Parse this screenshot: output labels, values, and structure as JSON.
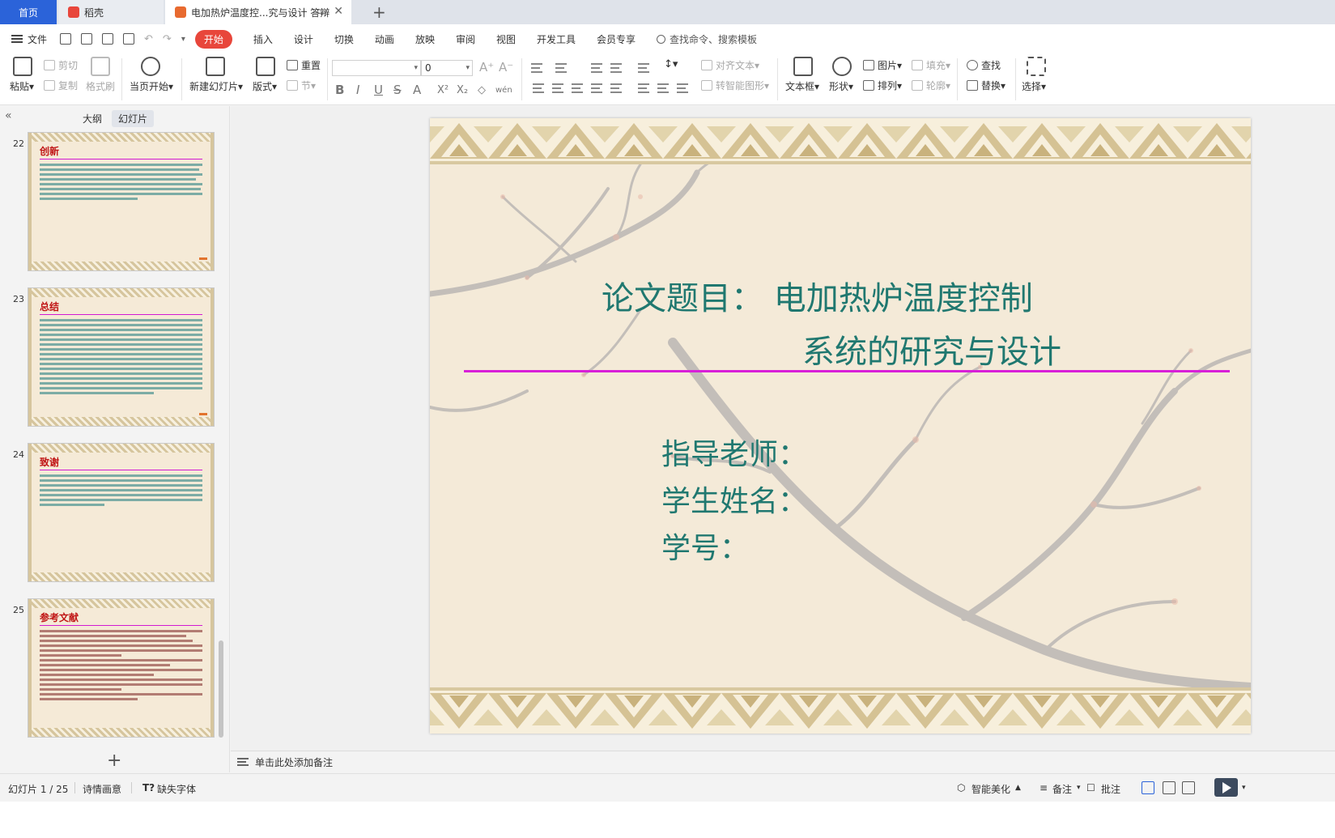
{
  "tabs": {
    "home": "首页",
    "docer": "稻壳",
    "doc": "电加热炉温度控...究与设计 答辩",
    "add": "+"
  },
  "menu": {
    "file": "文件",
    "items": [
      "开始",
      "插入",
      "设计",
      "切换",
      "动画",
      "放映",
      "审阅",
      "视图",
      "开发工具",
      "会员专享"
    ],
    "active": "开始",
    "search_placeholder": "查找命令、搜索模板"
  },
  "ribbon": {
    "paste": "粘贴",
    "cut": "剪切",
    "copy": "复制",
    "format_painter": "格式刷",
    "from_first": "当页开始",
    "new_slide": "新建幻灯片",
    "layout": "版式",
    "reset": "重置",
    "section": "节",
    "font_name": "",
    "font_size": "0",
    "bold": "B",
    "italic": "I",
    "underline": "U",
    "strike": "S",
    "font_color": "A",
    "superscript": "X²",
    "subscript": "X₂",
    "eraser": "◇",
    "phonetic": "wén",
    "align_text": "对齐文本",
    "smartart": "转智能图形",
    "textbox": "文本框",
    "shape": "形状",
    "picture": "图片",
    "fill": "填充",
    "arrange": "排列",
    "outline": "轮廓",
    "find": "查找",
    "replace": "替换",
    "select": "选择"
  },
  "panel": {
    "collapse": "«",
    "tab_outline": "大纲",
    "tab_slides": "幻灯片",
    "add": "+"
  },
  "thumbnails": [
    {
      "num": "22",
      "title": "创新"
    },
    {
      "num": "23",
      "title": "总结"
    },
    {
      "num": "24",
      "title": "致谢"
    },
    {
      "num": "25",
      "title": "参考文献"
    }
  ],
  "slide": {
    "title_line1": "论文题目：   电加热炉温度控制",
    "title_line2": "系统的研究与设计",
    "advisor": "指导老师：",
    "student": "学生姓名：",
    "student_id": "学号："
  },
  "notes": {
    "placeholder": "单击此处添加备注"
  },
  "status": {
    "slide_counter": "幻灯片 1 / 25",
    "theme": "诗情画意",
    "missing_font": "缺失字体",
    "beautify": "智能美化",
    "notes": "备注",
    "comment": "批注"
  },
  "colors": {
    "accent": "#e8463b",
    "tab_active": "#2b63d9",
    "slide_text": "#207870",
    "slide_rule": "#d820d8",
    "thumb_title": "#c01515"
  }
}
